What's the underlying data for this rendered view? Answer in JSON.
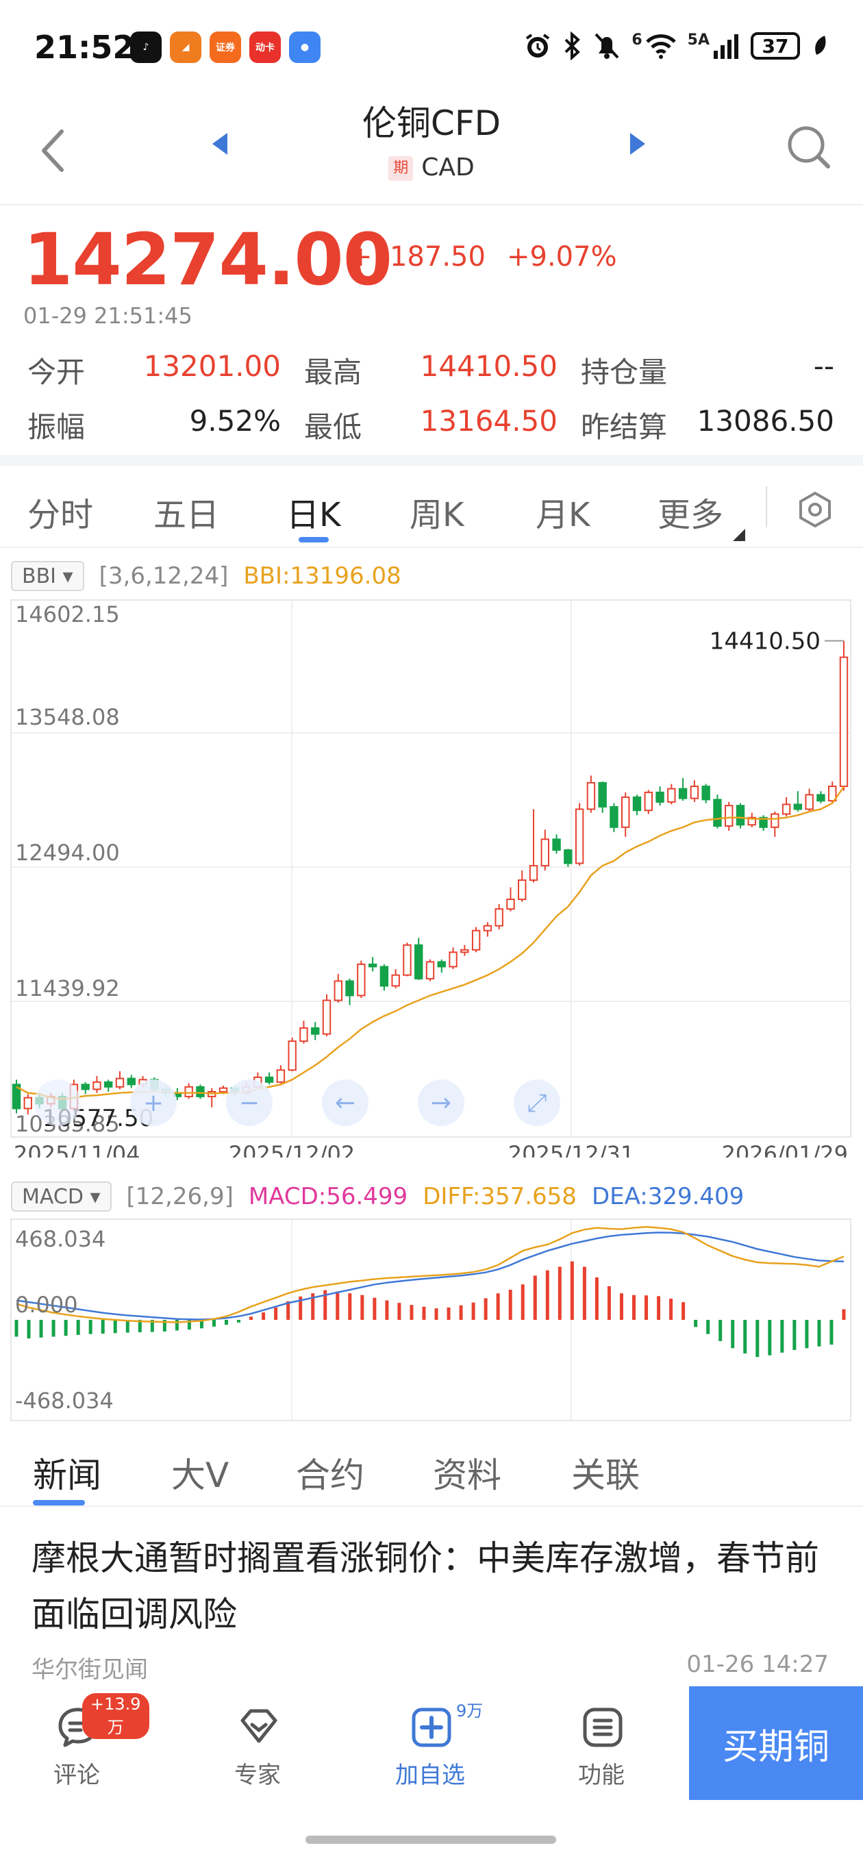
{
  "status_bar": {
    "time": "21:52",
    "apps": [
      {
        "name": "tiktok-app-icon",
        "glyph": "♪",
        "color": "#111111"
      },
      {
        "name": "feishu-app-icon",
        "glyph": "◢",
        "color": "#f07c20"
      },
      {
        "name": "securities-app-icon",
        "glyph": "证券",
        "color": "#f56b1e"
      },
      {
        "name": "dongfang-app-icon",
        "glyph": "动卡",
        "color": "#e8312a"
      },
      {
        "name": "message-app-icon",
        "glyph": "●",
        "color": "#3f86f3"
      }
    ],
    "network_label": "5A",
    "sim_label": "6",
    "battery": "37"
  },
  "nav": {
    "title": "伦铜CFD",
    "badge": "期",
    "subtitle": "CAD"
  },
  "quote": {
    "price": "14274.00",
    "change": "+1187.50",
    "change_pct": "+9.07%",
    "time": "01-29 21:51:45",
    "fields": [
      {
        "label": "今开",
        "value": "13201.00",
        "color": "red"
      },
      {
        "label": "最高",
        "value": "14410.50",
        "color": "red"
      },
      {
        "label": "持仓量",
        "value": "--",
        "color": "dark"
      },
      {
        "label": "振幅",
        "value": "9.52%",
        "color": "dark"
      },
      {
        "label": "最低",
        "value": "13164.50",
        "color": "red"
      },
      {
        "label": "昨结算",
        "value": "13086.50",
        "color": "dark"
      }
    ]
  },
  "period_tabs": [
    {
      "label": "分时",
      "active": false
    },
    {
      "label": "五日",
      "active": false
    },
    {
      "label": "日K",
      "active": true
    },
    {
      "label": "周K",
      "active": false
    },
    {
      "label": "月K",
      "active": false
    },
    {
      "label": "更多",
      "active": false
    }
  ],
  "chart_header": {
    "indicator": "BBI ▾",
    "params": "[3,6,12,24]",
    "value": "BBI:13196.08"
  },
  "macd_header": {
    "indicator": "MACD ▾",
    "params": "[12,26,9]",
    "macd": "MACD:56.499",
    "diff": "DIFF:357.658",
    "dea": "DEA:329.409"
  },
  "chart_data": [
    {
      "type": "candlestick",
      "yticks": [
        "14602.15",
        "13548.08",
        "12494.00",
        "11439.92",
        "10385.85"
      ],
      "ylim": [
        10385.85,
        14602.15
      ],
      "xticks": [
        "2025/11/04",
        "2025/12/02",
        "2025/12/31",
        "2026/01/29"
      ],
      "high_label": "14410.50",
      "low_label": "10577.50",
      "colors": {
        "up": "#e8412f",
        "down": "#14a34a",
        "bbi": "#e8a11c"
      },
      "candles": [
        [
          10720,
          10520,
          10760,
          10480
        ],
        [
          10520,
          10610,
          10640,
          10470
        ],
        [
          10610,
          10560,
          10650,
          10520
        ],
        [
          10560,
          10620,
          10650,
          10530
        ],
        [
          10620,
          10520,
          10650,
          10500
        ],
        [
          10520,
          10720,
          10760,
          10500
        ],
        [
          10720,
          10680,
          10740,
          10640
        ],
        [
          10680,
          10740,
          10790,
          10650
        ],
        [
          10740,
          10700,
          10760,
          10660
        ],
        [
          10700,
          10770,
          10830,
          10680
        ],
        [
          10770,
          10720,
          10800,
          10690
        ],
        [
          10720,
          10760,
          10790,
          10690
        ],
        [
          10760,
          10680,
          10780,
          10650
        ],
        [
          10680,
          10650,
          10710,
          10620
        ],
        [
          10650,
          10620,
          10690,
          10590
        ],
        [
          10620,
          10700,
          10730,
          10600
        ],
        [
          10700,
          10620,
          10720,
          10600
        ],
        [
          10620,
          10660,
          10690,
          10530
        ],
        [
          10660,
          10690,
          10710,
          10640
        ],
        [
          10690,
          10650,
          10710,
          10620
        ],
        [
          10650,
          10700,
          10740,
          10630
        ],
        [
          10700,
          10780,
          10820,
          10690
        ],
        [
          10780,
          10740,
          10820,
          10720
        ],
        [
          10740,
          10840,
          10880,
          10730
        ],
        [
          10840,
          11080,
          11110,
          10830
        ],
        [
          11080,
          11190,
          11250,
          11060
        ],
        [
          11190,
          11140,
          11240,
          11090
        ],
        [
          11140,
          11420,
          11470,
          11120
        ],
        [
          11420,
          11580,
          11640,
          11400
        ],
        [
          11580,
          11460,
          11600,
          11380
        ],
        [
          11460,
          11720,
          11750,
          11440
        ],
        [
          11720,
          11700,
          11780,
          11660
        ],
        [
          11700,
          11540,
          11720,
          11500
        ],
        [
          11540,
          11630,
          11680,
          11520
        ],
        [
          11630,
          11880,
          11900,
          11620
        ],
        [
          11880,
          11600,
          11940,
          11590
        ],
        [
          11600,
          11740,
          11760,
          11580
        ],
        [
          11740,
          11700,
          11760,
          11650
        ],
        [
          11700,
          11820,
          11860,
          11680
        ],
        [
          11820,
          11840,
          11880,
          11790
        ],
        [
          11840,
          12000,
          12030,
          11820
        ],
        [
          12000,
          12040,
          12070,
          11950
        ],
        [
          12040,
          12180,
          12220,
          12010
        ],
        [
          12180,
          12260,
          12360,
          12160
        ],
        [
          12260,
          12420,
          12500,
          12240
        ],
        [
          12420,
          12540,
          13010,
          12400
        ],
        [
          12540,
          12760,
          12840,
          12500
        ],
        [
          12760,
          12670,
          12800,
          12640
        ],
        [
          12670,
          12560,
          12680,
          12530
        ],
        [
          12560,
          13010,
          13060,
          12540
        ],
        [
          13010,
          13230,
          13290,
          12980
        ],
        [
          13230,
          13030,
          13240,
          12980
        ],
        [
          13030,
          12860,
          13060,
          12820
        ],
        [
          12860,
          13110,
          13150,
          12780
        ],
        [
          13110,
          13000,
          13130,
          12960
        ],
        [
          13000,
          13150,
          13170,
          12970
        ],
        [
          13150,
          13070,
          13200,
          13040
        ],
        [
          13070,
          13180,
          13220,
          13050
        ],
        [
          13180,
          13100,
          13270,
          13080
        ],
        [
          13100,
          13200,
          13250,
          13070
        ],
        [
          13200,
          13090,
          13220,
          13060
        ],
        [
          13090,
          12870,
          13130,
          12850
        ],
        [
          12870,
          13040,
          13070,
          12830
        ],
        [
          13040,
          12880,
          13060,
          12850
        ],
        [
          12880,
          12940,
          12980,
          12860
        ],
        [
          12940,
          12860,
          12960,
          12830
        ],
        [
          12860,
          12970,
          12990,
          12780
        ],
        [
          12970,
          13050,
          13110,
          12950
        ],
        [
          13050,
          13010,
          13160,
          12990
        ],
        [
          13010,
          13130,
          13180,
          12990
        ],
        [
          13130,
          13080,
          13160,
          13060
        ],
        [
          13080,
          13200,
          13240,
          13060
        ],
        [
          13200,
          14274,
          14410.5,
          13164.5
        ]
      ],
      "bbi": [
        10700,
        10650,
        10640,
        10610,
        10600,
        10610,
        10625,
        10630,
        10640,
        10650,
        10655,
        10660,
        10660,
        10660,
        10650,
        10650,
        10650,
        10645,
        10650,
        10650,
        10660,
        10680,
        10700,
        10720,
        10760,
        10820,
        10880,
        10950,
        11030,
        11100,
        11180,
        11240,
        11290,
        11330,
        11380,
        11420,
        11460,
        11490,
        11520,
        11550,
        11590,
        11630,
        11680,
        11740,
        11810,
        11900,
        12010,
        12120,
        12200,
        12320,
        12460,
        12540,
        12580,
        12650,
        12700,
        12740,
        12790,
        12830,
        12860,
        12900,
        12920,
        12930,
        12940,
        12940,
        12930,
        12930,
        12930,
        12940,
        12960,
        12990,
        13010,
        13060,
        13196.08
      ]
    },
    {
      "type": "bar",
      "title": "MACD",
      "yticks": [
        "468.034",
        "0.000",
        "-468.034"
      ],
      "ylim": [
        -468.034,
        468.034
      ],
      "colors": {
        "pos": "#e8412f",
        "neg": "#14a34a",
        "diff": "#e8a11c",
        "dea": "#3f78d6"
      },
      "hist": [
        -95,
        -105,
        -100,
        -95,
        -90,
        -85,
        -80,
        -78,
        -75,
        -72,
        -70,
        -68,
        -66,
        -60,
        -55,
        -48,
        -38,
        -28,
        -15,
        18,
        42,
        70,
        105,
        132,
        150,
        168,
        160,
        150,
        140,
        125,
        110,
        96,
        84,
        74,
        65,
        70,
        82,
        98,
        122,
        150,
        170,
        200,
        250,
        280,
        300,
        330,
        300,
        240,
        190,
        150,
        140,
        138,
        134,
        120,
        100,
        -40,
        -80,
        -120,
        -160,
        -190,
        -210,
        -200,
        -185,
        -170,
        -160,
        -150,
        -140,
        60
      ],
      "diff": [
        90,
        70,
        55,
        40,
        30,
        20,
        12,
        5,
        0,
        -5,
        -8,
        -10,
        -12,
        -14,
        -10,
        -5,
        5,
        20,
        45,
        75,
        100,
        125,
        150,
        170,
        185,
        195,
        205,
        215,
        222,
        230,
        236,
        240,
        244,
        248,
        252,
        256,
        262,
        270,
        285,
        310,
        350,
        390,
        410,
        425,
        455,
        490,
        510,
        520,
        515,
        512,
        520,
        525,
        520,
        512,
        495,
        460,
        420,
        390,
        360,
        340,
        325,
        320,
        318,
        316,
        310,
        300,
        330,
        357.658
      ],
      "dea": [
        110,
        100,
        90,
        80,
        70,
        60,
        50,
        40,
        32,
        25,
        20,
        15,
        10,
        5,
        3,
        2,
        5,
        10,
        20,
        35,
        55,
        75,
        95,
        110,
        125,
        140,
        155,
        170,
        185,
        200,
        210,
        218,
        225,
        232,
        238,
        244,
        250,
        258,
        268,
        285,
        310,
        340,
        365,
        390,
        410,
        430,
        445,
        460,
        472,
        480,
        485,
        490,
        493,
        492,
        488,
        480,
        470,
        455,
        440,
        420,
        400,
        385,
        370,
        355,
        345,
        335,
        332,
        329.409
      ]
    }
  ],
  "chart_controls": [
    {
      "name": "zoom-in-button",
      "glyph": "+"
    },
    {
      "name": "zoom-out-button",
      "glyph": "−"
    },
    {
      "name": "scroll-left-button",
      "glyph": "←"
    },
    {
      "name": "scroll-right-button",
      "glyph": "→"
    },
    {
      "name": "fullscreen-button",
      "glyph": "⤢"
    }
  ],
  "news_tabs": [
    {
      "label": "新闻",
      "active": true
    },
    {
      "label": "大V",
      "active": false
    },
    {
      "label": "合约",
      "active": false
    },
    {
      "label": "资料",
      "active": false
    },
    {
      "label": "关联",
      "active": false
    }
  ],
  "news": {
    "title": "摩根大通暂时搁置看涨铜价：中美库存激增，春节前面临回调风险",
    "source": "华尔街见闻",
    "time": "01-26 14:27"
  },
  "bottom_bar": {
    "comment_label": "评论",
    "comment_badge": "+13.9万",
    "expert_label": "专家",
    "watch_label": "加自选",
    "watch_sup": "9万",
    "function_label": "功能",
    "buy_label": "买期铜"
  }
}
